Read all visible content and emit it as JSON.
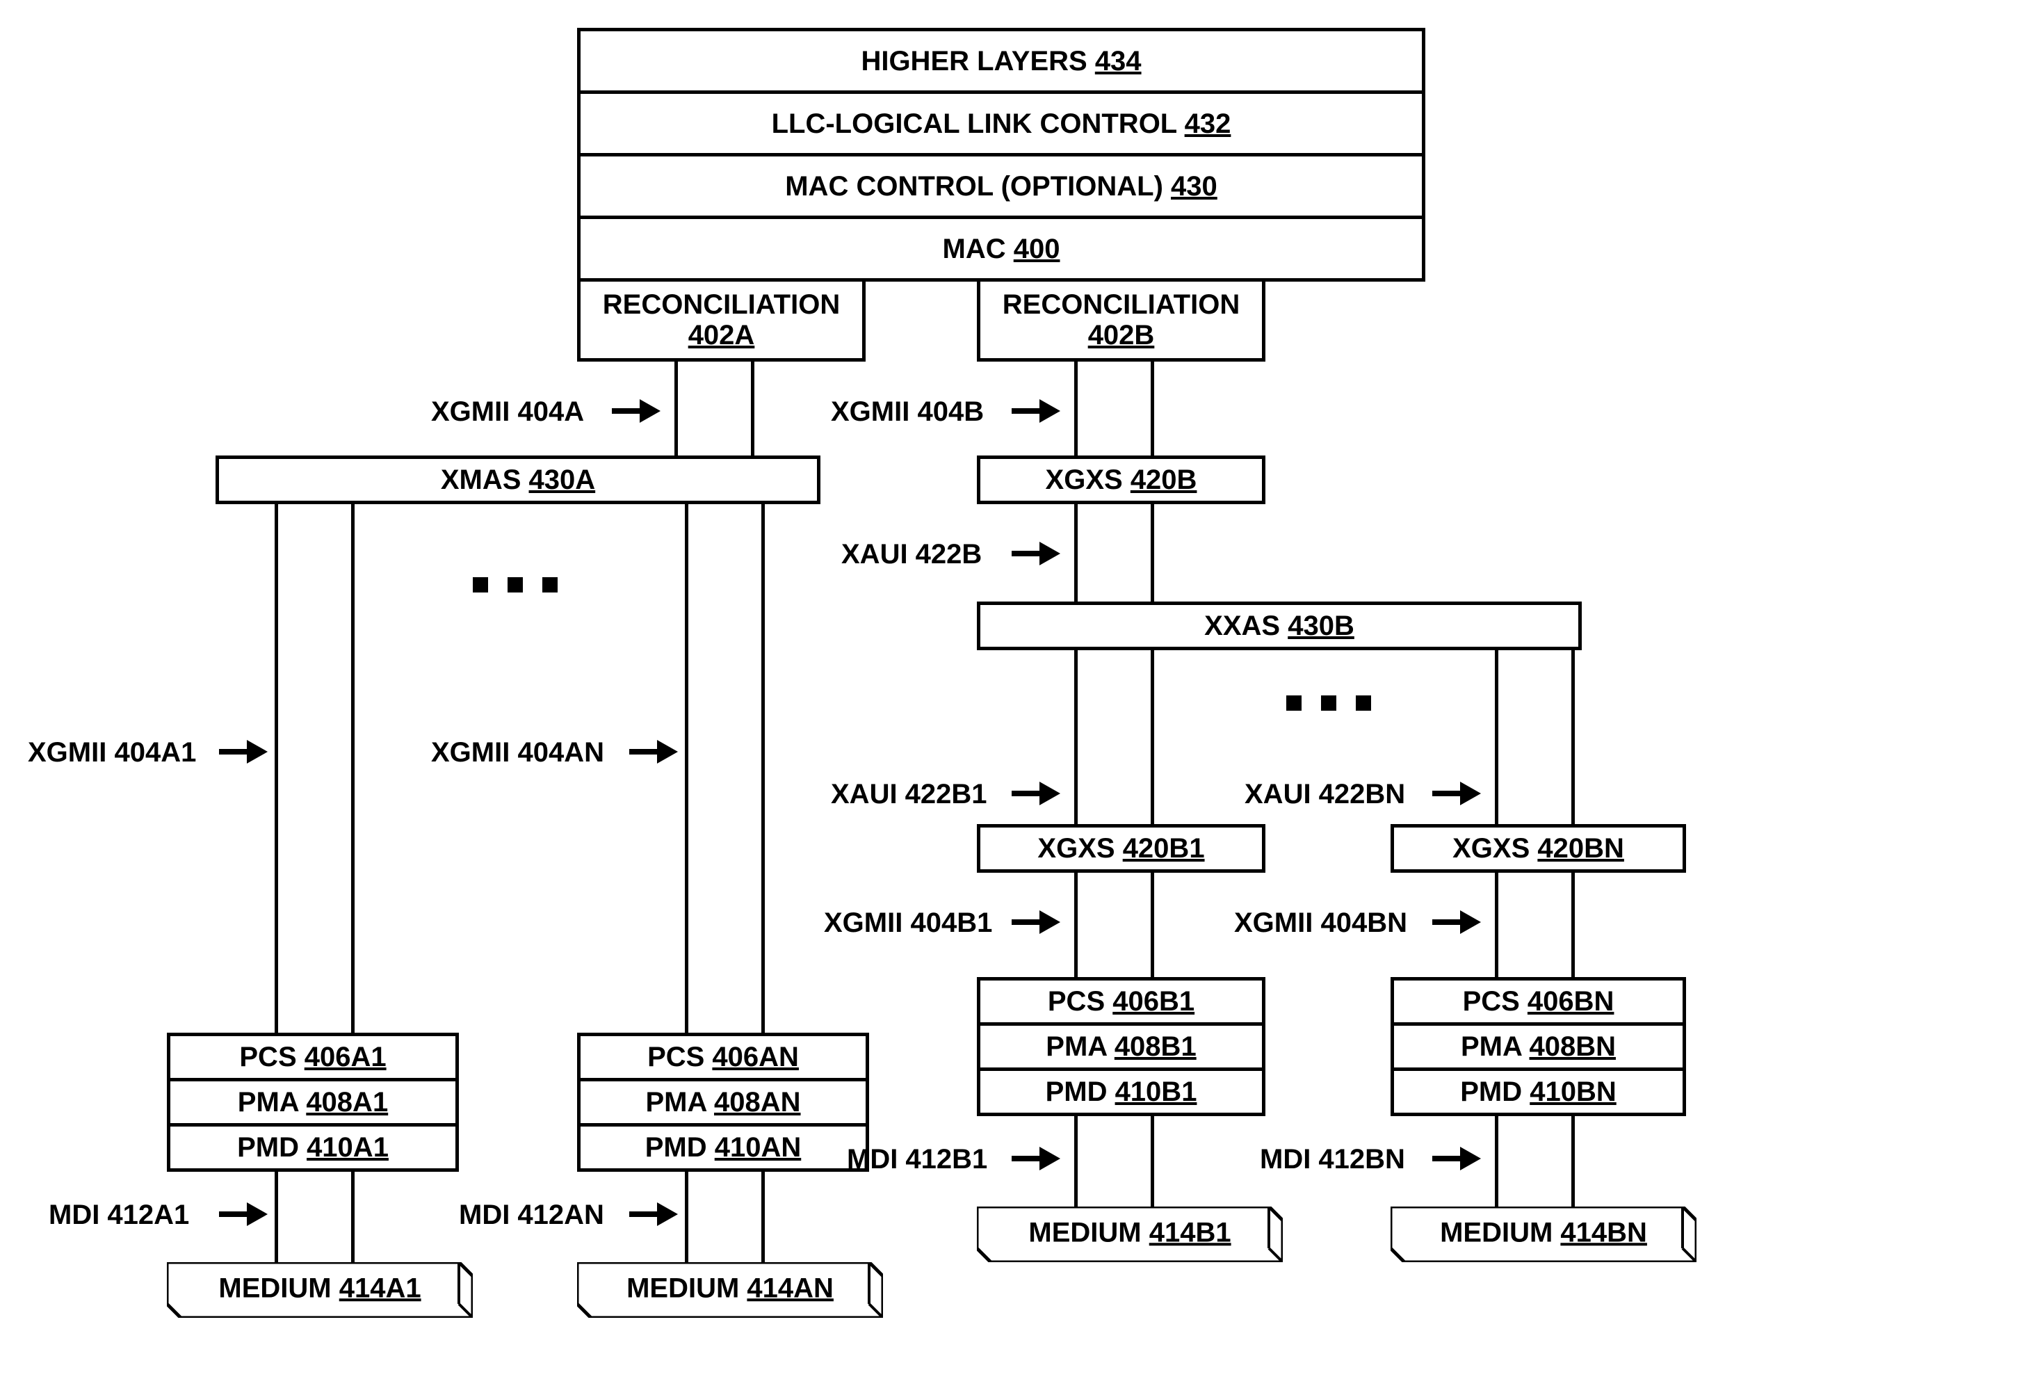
{
  "stack": {
    "higher": {
      "label": "HIGHER LAYERS ",
      "ref": "434"
    },
    "llc": {
      "label": "LLC-LOGICAL LINK CONTROL ",
      "ref": "432"
    },
    "macctrl": {
      "label": "MAC CONTROL (OPTIONAL) ",
      "ref": "430"
    },
    "mac": {
      "label": "MAC ",
      "ref": "400"
    }
  },
  "recon": {
    "a": {
      "label": "RECONCILIATION",
      "ref": "402A"
    },
    "b": {
      "label": "RECONCILIATION",
      "ref": "402B"
    }
  },
  "xgmii": {
    "a": {
      "label": "XGMII 404A"
    },
    "b": {
      "label": "XGMII 404B"
    },
    "a1": {
      "label": "XGMII 404A1"
    },
    "an": {
      "label": "XGMII 404AN"
    },
    "b1": {
      "label": "XGMII 404B1"
    },
    "bn": {
      "label": "XGMII 404BN"
    }
  },
  "xmas": {
    "label": "XMAS ",
    "ref": "430A"
  },
  "xgxs": {
    "b": {
      "label": "XGXS ",
      "ref": "420B"
    },
    "b1": {
      "label": "XGXS ",
      "ref": "420B1"
    },
    "bn": {
      "label": "XGXS ",
      "ref": "420BN"
    }
  },
  "xaui": {
    "b": {
      "label": "XAUI 422B"
    },
    "b1": {
      "label": "XAUI 422B1"
    },
    "bn": {
      "label": "XAUI 422BN"
    }
  },
  "xxas": {
    "label": "XXAS ",
    "ref": "430B"
  },
  "phy": {
    "a1": {
      "pcs": {
        "l": "PCS ",
        "r": "406A1"
      },
      "pma": {
        "l": "PMA ",
        "r": "408A1"
      },
      "pmd": {
        "l": "PMD ",
        "r": "410A1"
      }
    },
    "an": {
      "pcs": {
        "l": "PCS ",
        "r": "406AN"
      },
      "pma": {
        "l": "PMA ",
        "r": "408AN"
      },
      "pmd": {
        "l": "PMD ",
        "r": "410AN"
      }
    },
    "b1": {
      "pcs": {
        "l": "PCS ",
        "r": "406B1"
      },
      "pma": {
        "l": "PMA ",
        "r": "408B1"
      },
      "pmd": {
        "l": "PMD ",
        "r": "410B1"
      }
    },
    "bn": {
      "pcs": {
        "l": "PCS ",
        "r": "406BN"
      },
      "pma": {
        "l": "PMA ",
        "r": "408BN"
      },
      "pmd": {
        "l": "PMD ",
        "r": "410BN"
      }
    }
  },
  "mdi": {
    "a1": {
      "label": "MDI 412A1"
    },
    "an": {
      "label": "MDI 412AN"
    },
    "b1": {
      "label": "MDI 412B1"
    },
    "bn": {
      "label": "MDI 412BN"
    }
  },
  "medium": {
    "a1": {
      "l": "MEDIUM ",
      "r": "414A1"
    },
    "an": {
      "l": "MEDIUM ",
      "r": "414AN"
    },
    "b1": {
      "l": "MEDIUM ",
      "r": "414B1"
    },
    "bn": {
      "l": "MEDIUM ",
      "r": "414BN"
    }
  }
}
